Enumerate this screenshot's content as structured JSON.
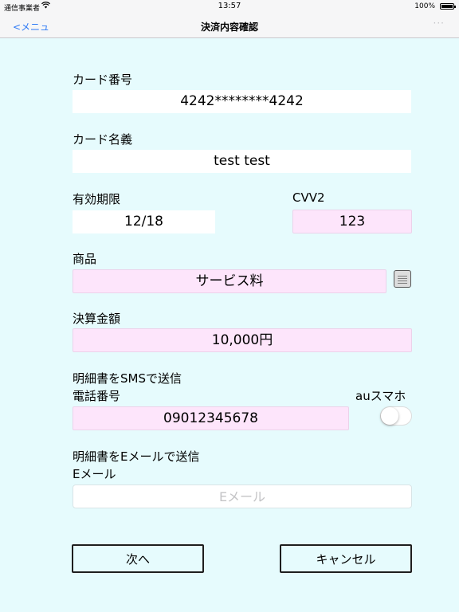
{
  "status_bar": {
    "carrier": "通信事業者",
    "time": "13:57",
    "battery": "100%"
  },
  "nav": {
    "back_label": "<メニュ",
    "title": "決済内容確認",
    "more": "···"
  },
  "card_number": {
    "label": "カード番号",
    "value": "4242********4242"
  },
  "card_holder": {
    "label": "カード名義",
    "value": "test test"
  },
  "expiry": {
    "label": "有効期限",
    "value": "12/18"
  },
  "cvv": {
    "label": "CVV2",
    "value": "123"
  },
  "product": {
    "label": "商品",
    "value": "サービス料"
  },
  "amount": {
    "label": "決算金額",
    "value": "10,000円"
  },
  "sms": {
    "section_label": "明細書をSMSで送信",
    "phone_label": "電話番号",
    "phone_value": "09012345678",
    "au_label": "auスマホ",
    "au_enabled": false
  },
  "email": {
    "section_label": "明細書をEメールで送信",
    "label": "Eメール",
    "placeholder": "Eメール",
    "value": ""
  },
  "buttons": {
    "next": "次へ",
    "cancel": "キャンセル"
  }
}
